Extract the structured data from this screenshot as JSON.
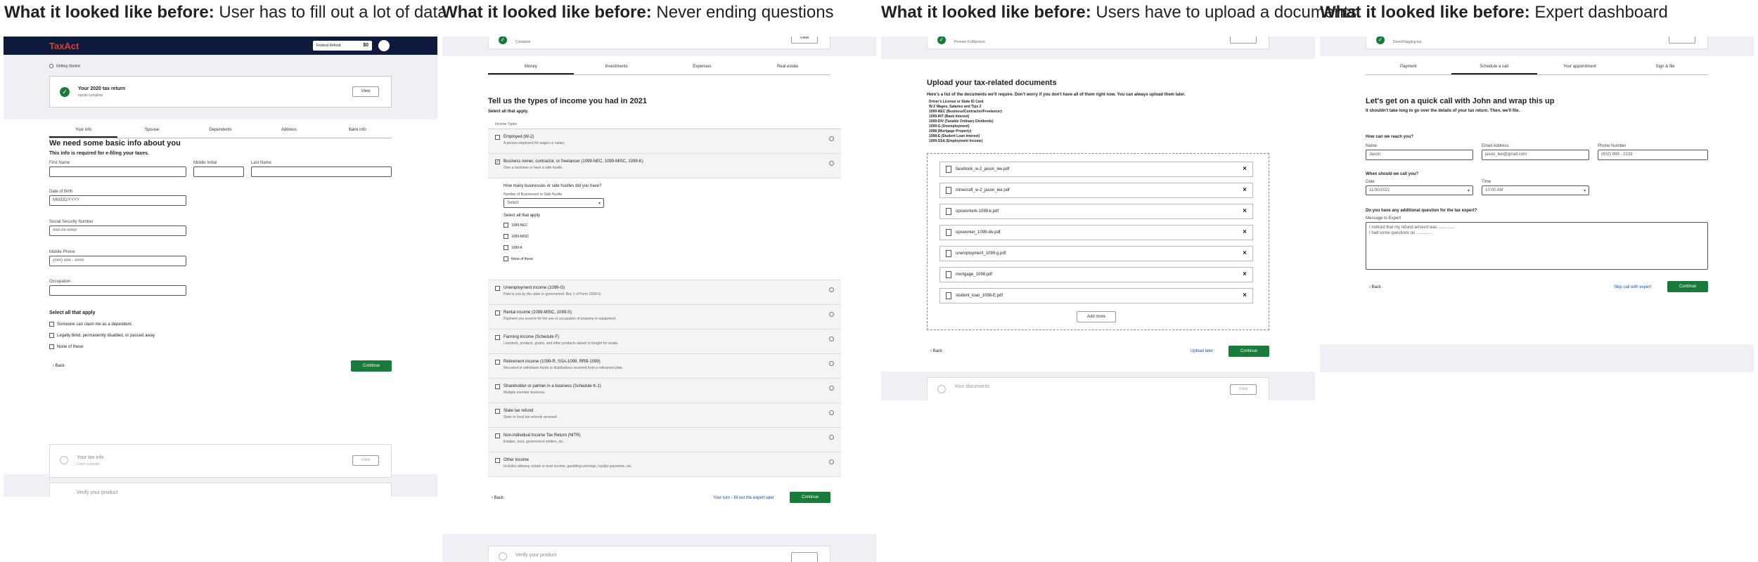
{
  "captions": [
    {
      "bold": "What it looked like before:",
      "text": " User has to fill out a lot of data"
    },
    {
      "bold": "What it looked like before:",
      "text": " Never ending questions"
    },
    {
      "bold": "What it looked like before:",
      "text": " Users have to upload a documents"
    },
    {
      "bold": "What it looked like before:",
      "text": " Expert dashboard"
    }
  ],
  "colors": {
    "header": "#0f1b3d",
    "brand_red": "#e03c31",
    "green": "#1a7a3a",
    "panel_bg": "#eef0f5"
  },
  "p1": {
    "logo": "TaxAct",
    "refund_label": "Federal Refund",
    "refund_value": "$0",
    "getting_started": "Getting Started",
    "return_title": "Your 2020 tax return",
    "return_sub": "Inputs complete",
    "view": "View",
    "tabs": [
      "Your info",
      "Spouse",
      "Dependents",
      "Address",
      "Bank info"
    ],
    "heading": "We need some basic info about you",
    "subheading": "This info is required for e-filing your taxes.",
    "first": "First Name",
    "middle": "Middle Initial",
    "last": "Last Name",
    "dob": "Date of Birth",
    "dob_ph": "MM/DD/YYYY",
    "ssn": "Social Security Number",
    "ssn_ph": "###-##-####",
    "mobile": "Mobile Phone",
    "mobile_ph": "(###) ### - ####",
    "occupation": "Occupation",
    "select_all": "Select all that apply",
    "opts": [
      "Someone can claim me as a dependent.",
      "Legally blind, permanently disabled, or passed away",
      "None of these"
    ],
    "back": "Back",
    "continue": "Continue",
    "foot1": "Your tax info",
    "foot1_sub": "Claim a details",
    "foot_view": "View",
    "foot2": "Verify your product"
  },
  "p2": {
    "top_sub": "Complete",
    "view": "View",
    "tabs": [
      "Money",
      "Investments",
      "Expenses",
      "Real estate"
    ],
    "heading": "Tell us the types of income you had in 2021",
    "select": "Select all that apply.",
    "col": "Income Types",
    "items": [
      {
        "t": "Employed (W-2)",
        "s": "A person employed for wages or salary"
      },
      {
        "t": "Business owner, contractor, or freelancer (1099-NEC, 1099-MISC, 1099-K)",
        "s": "Own a business or have a side hustle."
      },
      {
        "t": "Unemployment income (1099-G)",
        "s": "Paid to you by the state or government. Box 1 of Form 1099-G."
      },
      {
        "t": "Rental income (1099-MISC, 1099-S)",
        "s": "Payment you receive for the use or occupation of property or equipment."
      },
      {
        "t": "Farming income (Schedule F)",
        "s": "Livestock, produce, grains, and other products raised or bought for resale."
      },
      {
        "t": "Retirement income (1099-R, SSA-1099, RRB-1099)",
        "s": "Received or withdrawn funds or distributions received from a retirement plan."
      },
      {
        "t": "Shareholder or partner in a business (Schedule K-1)",
        "s": "Multiple member business."
      },
      {
        "t": "State tax refund",
        "s": "State or local tax refunds received."
      },
      {
        "t": "Non-individual Income Tax Return (NITR)",
        "s": "Estates, trust, government entities, etc."
      },
      {
        "t": "Other income",
        "s": "Includes alimony, estate or trust income, gambling winnings, royalty payments, etc."
      }
    ],
    "sub_q": "How many businesses or side hustles did you have?",
    "sub_lbl": "Number of Businesses or Side Hustle",
    "sub_sel": "Select",
    "sub_all": "Select all that apply",
    "sub_opts": [
      "1099-NEC",
      "1099-MISC",
      "1099-K",
      "None of these"
    ],
    "back": "Back",
    "talk": "Your turn - fill out the expert later",
    "continue": "Continue",
    "foot": "Verify your product"
  },
  "p3": {
    "top_sub": "Premier FullService",
    "heading": "Upload your tax-related documents",
    "intro": "Here's a list of the documents we'll require. Don't worry if you don't have all of them right now. You can always upload them later.",
    "docs": [
      "Driver's License or State ID Card",
      "W-2 Wages, Salaries and Tips 2",
      "1099-NEC (Business/Contractor/Freelancer)",
      "1099-INT (Bank Interest)",
      "1099-DIV (Taxable Ordinary Dividends)",
      "1099-G (Unemployment)",
      "1098 (Mortgage Property)",
      "1098-E (Student Loan Interest)",
      "1099-SSA (Employment Income)"
    ],
    "files": [
      "facebook_w-2_jason_lee.pdf",
      "minecraft_w-2_jason_lee.pdf",
      "opsworkerk-1099-k.pdf",
      "opsworker_1099-div.pdf",
      "unemployment_1099-g.pdf",
      "mortgage_1098.pdf",
      "student_loan_1098-E.pdf"
    ],
    "add": "Add more",
    "back": "Back",
    "upload_later": "Upload later",
    "continue": "Continue",
    "foot": "Your documents",
    "foot_view": "View"
  },
  "p4": {
    "top_sub": "Done/Flagging tax.",
    "tabs": [
      "Payment",
      "Schedule a call",
      "Your appointment",
      "Sign & file"
    ],
    "heading": "Let's get on a quick call with John and wrap this up",
    "sub": "It shouldn't take long to go over the details of your tax return. Then, we'll file.",
    "reach": "How can we reach you?",
    "name_l": "Name",
    "name_v": "Jason",
    "email_l": "Email Address",
    "email_v": "jason_lee@gmail.com",
    "phone_l": "Phone Number",
    "phone_v": "(602) 999 - 2233",
    "when": "When should we call you?",
    "date_l": "Date",
    "date_v": "11/30/2021",
    "time_l": "Time",
    "time_v": "10:00 AM",
    "q": "Do you have any additional question for the tax expert?",
    "msg_l": "Message to Expert",
    "msg_v": "I noticed that my refund amount was ..............",
    "msg_v2": "I had some questions on ..............",
    "back": "Back",
    "skip": "Skip call with expert",
    "continue": "Continue"
  }
}
